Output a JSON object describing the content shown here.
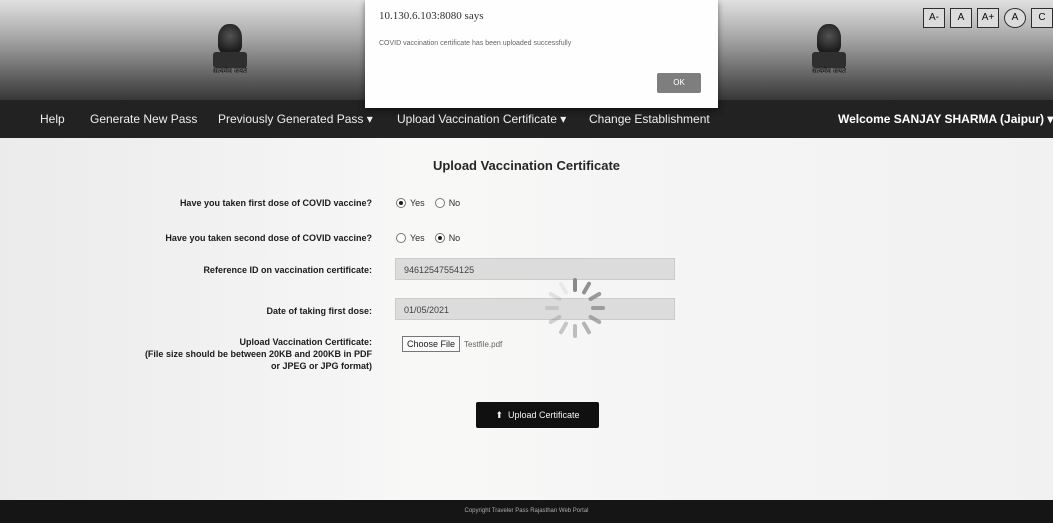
{
  "header": {
    "emblem_caption_left": "सत्यमेव जयते",
    "emblem_caption_right": "सत्यमेव जयते",
    "a11y": [
      "A-",
      "A",
      "A+",
      "A",
      "C"
    ]
  },
  "navbar": {
    "help": "Help",
    "generate": "Generate New Pass",
    "previous": "Previously Generated Pass ▾",
    "upload": "Upload Vaccination Certificate ▾",
    "change": "Change Establishment",
    "welcome": "Welcome SANJAY SHARMA (Jaipur) ▾"
  },
  "form": {
    "title": "Upload Vaccination Certificate",
    "q1": "Have you taken first dose of COVID vaccine?",
    "q1_yes": "Yes",
    "q1_no": "No",
    "q2": "Have you taken second dose of COVID vaccine?",
    "q2_yes": "Yes",
    "q2_no": "No",
    "ref_label": "Reference ID on vaccination certificate:",
    "ref_value": "94612547554125",
    "date_label": "Date of taking first dose:",
    "date_value": "01/05/2021",
    "upload_label": "Upload Vaccination Certificate:",
    "upload_note_1": "(File size should be between 20KB and 200KB in PDF",
    "upload_note_2": "or JPEG or JPG format)",
    "choose_file": "Choose File",
    "file_name": "Testfile.pdf",
    "submit": "Upload Certificate"
  },
  "footer": {
    "text": "Copyright Traveler Pass Rajasthan Web Portal"
  },
  "dialog": {
    "origin": "10.130.6.103:8080 says",
    "message": "COVID vaccination certificate has been uploaded successfully",
    "ok": "OK"
  }
}
